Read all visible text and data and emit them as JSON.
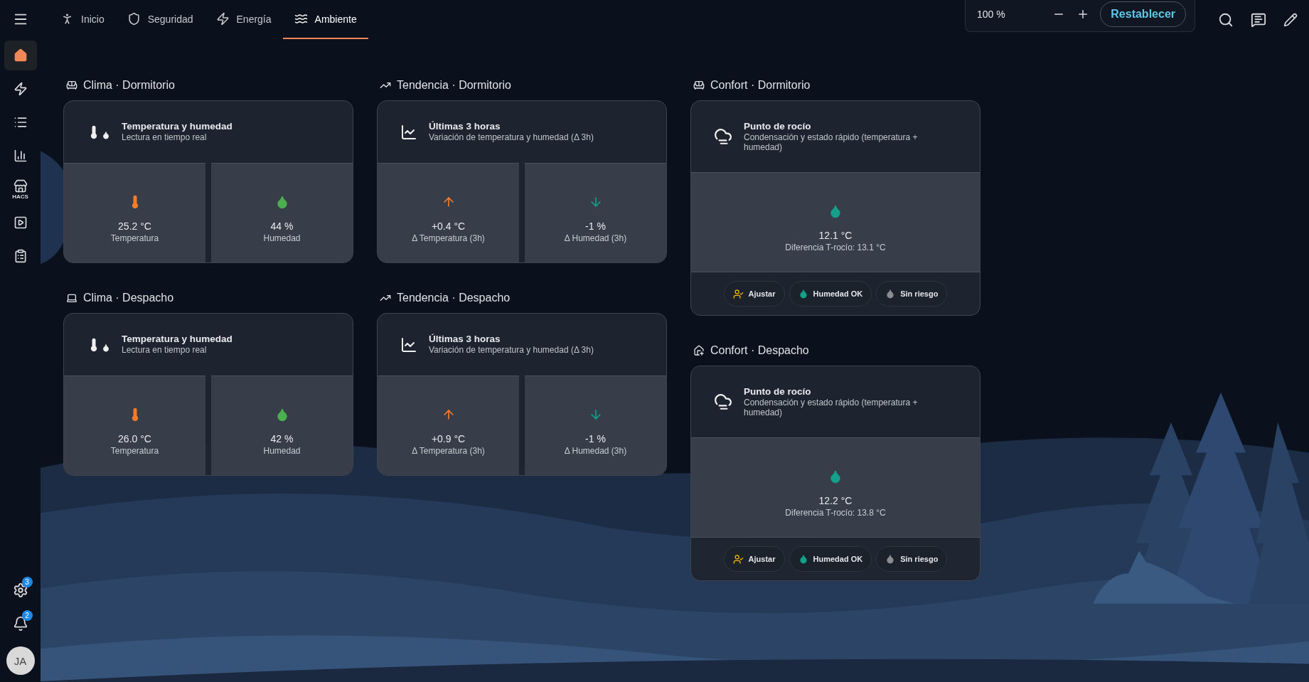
{
  "sidebar": {
    "items": [
      {
        "kind": "home",
        "selected": true
      },
      {
        "kind": "energy",
        "selected": false
      },
      {
        "kind": "list",
        "selected": false
      },
      {
        "kind": "chart",
        "selected": false
      },
      {
        "kind": "store",
        "label": "HACS",
        "selected": false
      },
      {
        "kind": "media",
        "selected": false
      },
      {
        "kind": "clipboard",
        "selected": false
      }
    ],
    "settings_badge": "3",
    "notifications_badge": "2",
    "avatar": "JA"
  },
  "tabs": [
    {
      "label": "Inicio",
      "kind": "walk",
      "selected": false
    },
    {
      "label": "Seguridad",
      "kind": "shield",
      "selected": false
    },
    {
      "label": "Energía",
      "kind": "energy",
      "selected": false
    },
    {
      "label": "Ambiente",
      "kind": "waves",
      "selected": true
    }
  ],
  "zoom_control": {
    "value": "100 %",
    "reset_button": "Restablecer"
  },
  "columns": [
    {
      "cards": [
        {
          "kind": "climate",
          "heading": "Clima · Dormitorio",
          "title": "Temperatura y humedad",
          "subtitle": "Lectura en tiempo real",
          "tiles": [
            {
              "kind": "temperature",
              "value": "25.2 °C",
              "label": "Temperatura"
            },
            {
              "kind": "humidity",
              "value": "44 %",
              "label": "Humedad"
            }
          ]
        },
        {
          "kind": "climate",
          "heading": "Clima · Despacho",
          "title": "Temperatura y humedad",
          "subtitle": "Lectura en tiempo real",
          "tiles": [
            {
              "kind": "temperature",
              "value": "26.0 °C",
              "label": "Temperatura"
            },
            {
              "kind": "humidity",
              "value": "42 %",
              "label": "Humedad"
            }
          ]
        }
      ]
    },
    {
      "cards": [
        {
          "kind": "trend",
          "heading": "Tendencia · Dormitorio",
          "title": "Últimas 3 horas",
          "subtitle": "Variación de temperatura y humedad (Δ 3h)",
          "tiles": [
            {
              "kind": "rise",
              "value": "+0.4 °C",
              "label": "Δ Temperatura (3h)"
            },
            {
              "kind": "fall",
              "value": "-1 %",
              "label": "Δ Humedad (3h)"
            }
          ]
        },
        {
          "kind": "trend",
          "heading": "Tendencia · Despacho",
          "title": "Últimas 3 horas",
          "subtitle": "Variación de temperatura y humedad (Δ 3h)",
          "tiles": [
            {
              "kind": "rise",
              "value": "+0.9 °C",
              "label": "Δ Temperatura (3h)"
            },
            {
              "kind": "fall",
              "value": "-1 %",
              "label": "Δ Humedad (3h)"
            }
          ]
        }
      ]
    },
    {
      "cards": [
        {
          "kind": "comfort",
          "heading": "Confort · Dormitorio",
          "title": "Punto de rocío",
          "subtitle": "Condensación y estado rápido (temperatura + humedad)",
          "tiles": [
            {
              "kind": "dewpoint",
              "value": "12.1 °C",
              "label": "Diferencia T-rocío: 13.1 °C"
            }
          ],
          "chips": [
            {
              "kind": "adjust",
              "label": "Ajustar"
            },
            {
              "kind": "humidity",
              "label": "Humedad OK"
            },
            {
              "kind": "risk",
              "label": "Sin riesgo"
            }
          ]
        },
        {
          "kind": "comfort",
          "heading": "Confort · Despacho",
          "title": "Punto de rocío",
          "subtitle": "Condensación y estado rápido (temperatura + humedad)",
          "tiles": [
            {
              "kind": "dewpoint",
              "value": "12.2 °C",
              "label": "Diferencia T-rocío: 13.8 °C"
            }
          ],
          "chips": [
            {
              "kind": "adjust",
              "label": "Ajustar"
            },
            {
              "kind": "humidity",
              "label": "Humedad OK"
            },
            {
              "kind": "risk",
              "label": "Sin riesgo"
            }
          ]
        }
      ]
    }
  ]
}
